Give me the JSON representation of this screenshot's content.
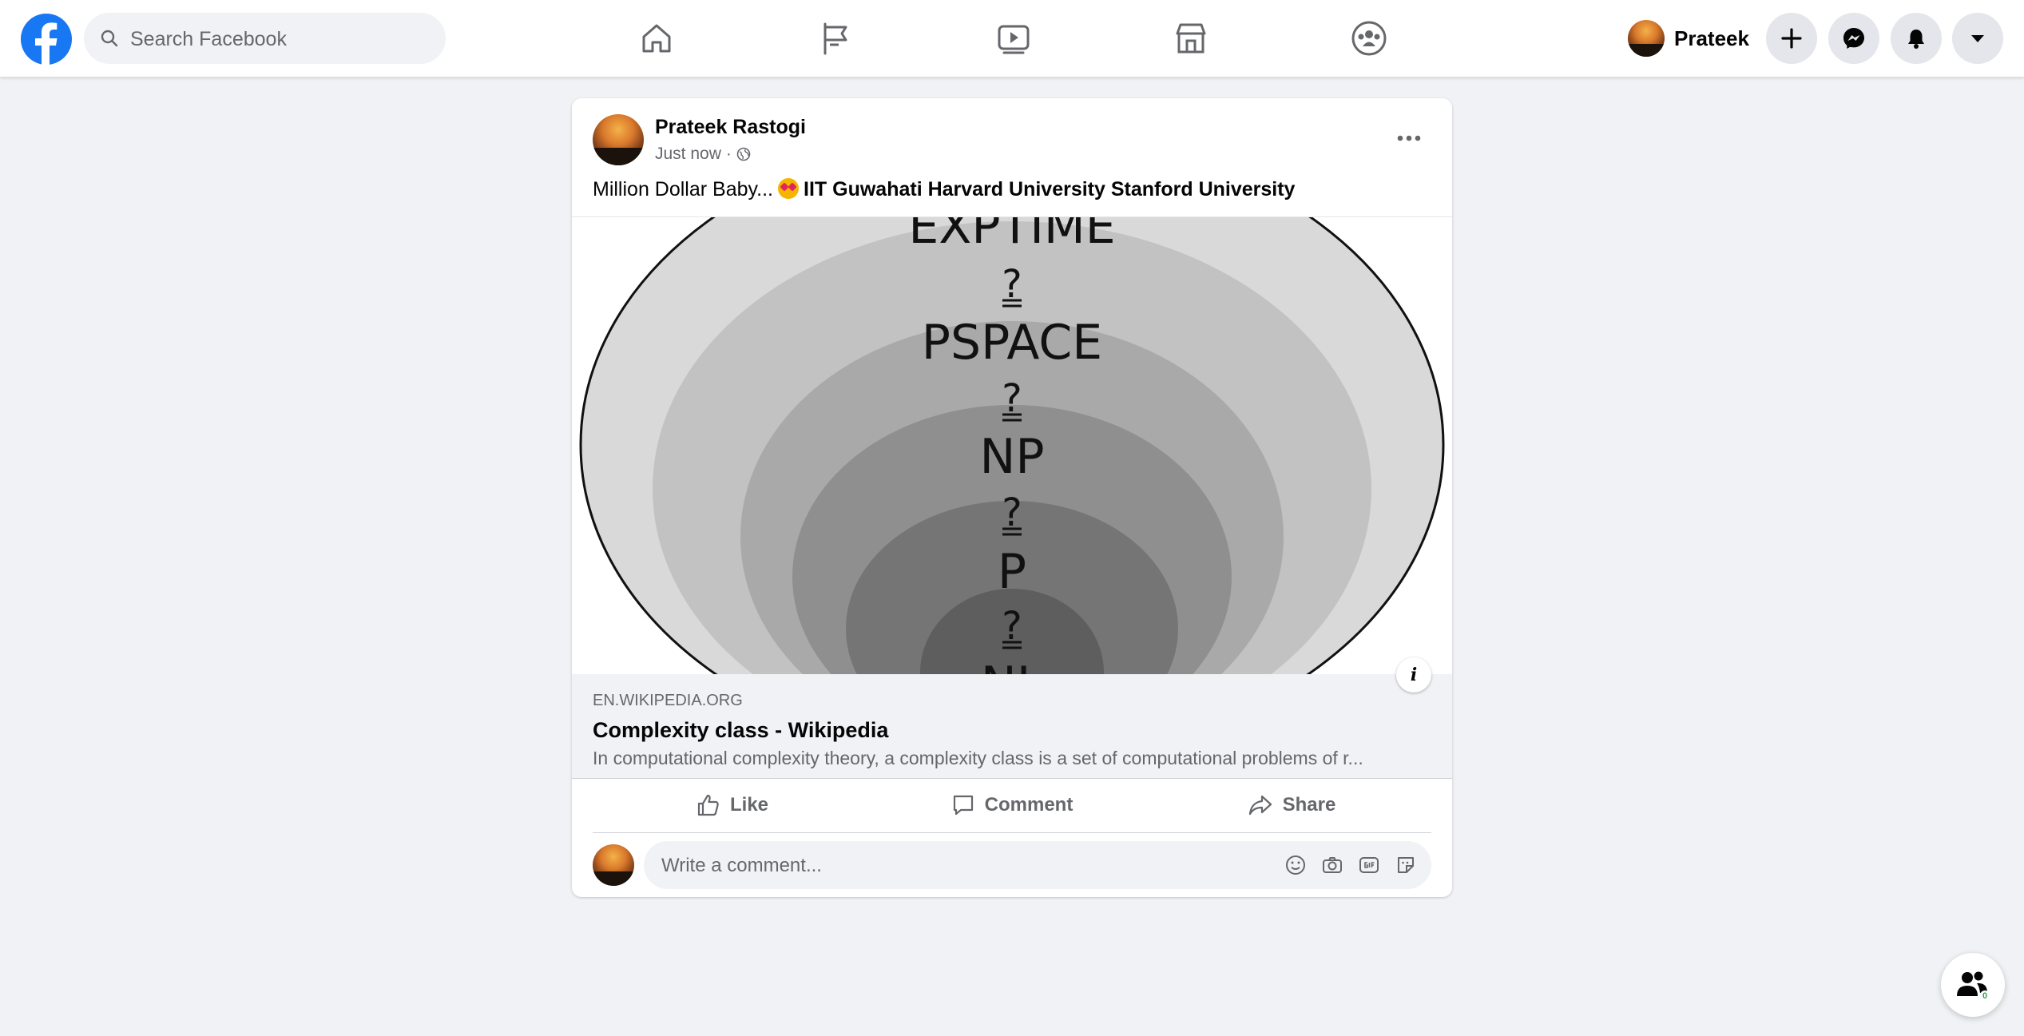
{
  "search": {
    "placeholder": "Search Facebook"
  },
  "nav_tabs": [
    "home-icon",
    "flag-icon",
    "watch-icon",
    "marketplace-icon",
    "groups-icon"
  ],
  "profile": {
    "name": "Prateek"
  },
  "header_buttons": [
    "plus-icon",
    "messenger-icon",
    "notifications-icon",
    "dropdown-icon"
  ],
  "post": {
    "author": "Prateek Rastogi",
    "time": "Just now",
    "separator": "·",
    "text_prefix": "Million Dollar Baby...",
    "tags": "IIT Guwahati Harvard University Stanford University",
    "link": {
      "domain": "EN.WIKIPEDIA.ORG",
      "title": "Complexity class - Wikipedia",
      "description": "In computational complexity theory, a complexity class is a set of computational problems of r..."
    },
    "diagram_labels": {
      "exptime": "EXPTIME",
      "pspace": "PSPACE",
      "np": "NP",
      "p": "P",
      "nl": "NL",
      "relation": "?"
    },
    "actions": {
      "like": "Like",
      "comment": "Comment",
      "share": "Share"
    },
    "comment_placeholder": "Write a comment..."
  },
  "contacts": {
    "badge": "0"
  },
  "colors": {
    "brand": "#1877f2",
    "bg": "#f0f2f5",
    "secondary_text": "#65676b"
  }
}
